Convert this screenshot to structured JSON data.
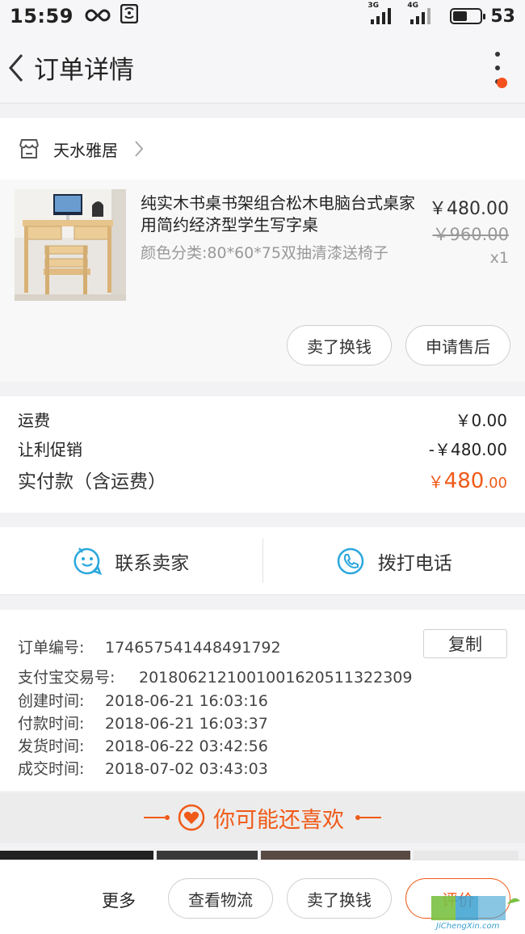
{
  "status_bar": {
    "time": "15:59",
    "battery": "53",
    "net_a": "3G",
    "net_b": "4G",
    "battery_level": 0.53
  },
  "nav": {
    "title": "订单详情"
  },
  "shop": {
    "name": "天水雅居"
  },
  "product": {
    "title": "纯实木书桌书架组合松木电脑台式桌家用简约经济型学生写字桌",
    "spec": "颜色分类:80*60*75双抽清漆送椅子",
    "price": "￥480.00",
    "original_price": "￥960.00",
    "quantity": "x1",
    "actions": [
      "卖了换钱",
      "申请售后"
    ]
  },
  "fees": {
    "shipping_label": "运费",
    "shipping_value": "￥0.00",
    "discount_label": "让利促销",
    "discount_value": "-￥480.00",
    "total_label": "实付款（含运费）",
    "total_currency": "￥",
    "total_int": "480",
    "total_dec": ".00"
  },
  "contact": {
    "seller": "联系卖家",
    "call": "拨打电话"
  },
  "order_info": {
    "copy_label": "复制",
    "lines": [
      {
        "key": "订单编号:",
        "value": "174657541448491792"
      },
      {
        "key": "支付宝交易号:",
        "value": "2018062121001001620511322309"
      },
      {
        "key": "创建时间:",
        "value": "2018-06-21 16:03:16"
      },
      {
        "key": "付款时间:",
        "value": "2018-06-21 16:03:37"
      },
      {
        "key": "发货时间:",
        "value": "2018-06-22 03:42:56"
      },
      {
        "key": "成交时间:",
        "value": "2018-07-02 03:43:03"
      }
    ]
  },
  "recommend": {
    "title": "你可能还喜欢"
  },
  "bottom_bar": {
    "more": "更多",
    "logistics": "查看物流",
    "sell": "卖了换钱",
    "review": "评价"
  },
  "watermark": {
    "logo_text": "集城信",
    "url": "JiChengXin.com"
  },
  "colors": {
    "accent": "#f05a18",
    "contact_icon": "#2aa7dd",
    "red_dot": "#f4511e"
  }
}
